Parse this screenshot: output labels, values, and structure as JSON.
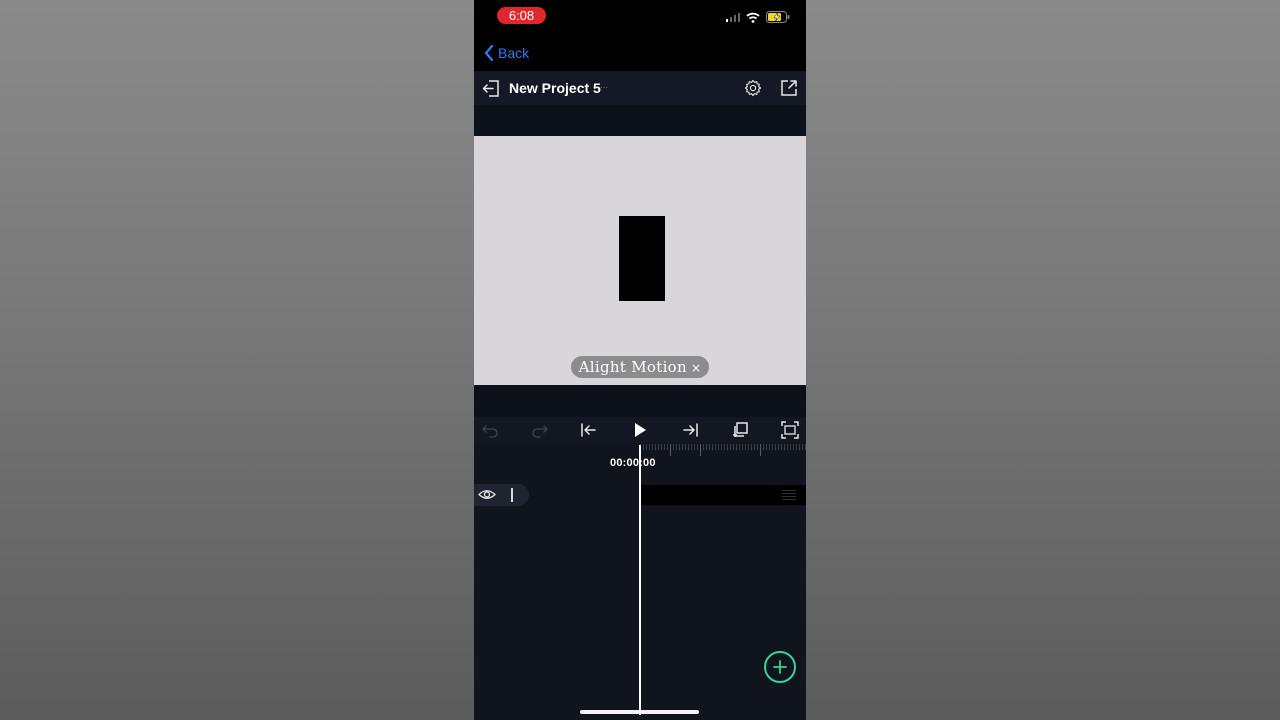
{
  "status_bar": {
    "time": "6:08"
  },
  "nav": {
    "back_label": "Back"
  },
  "project": {
    "title": "New Project 5",
    "title_suffix": "..."
  },
  "canvas": {
    "watermark_text": "Alight Motion",
    "watermark_close": "×"
  },
  "timeline": {
    "timecode": "00:00:00"
  },
  "colors": {
    "accent_blue": "#2f7cf6",
    "add_button_green": "#38d39a",
    "time_pill_red": "#e0272b",
    "canvas_bg": "#d8d6da"
  },
  "icons": {
    "status": [
      "cellular-signal-icon",
      "wifi-icon",
      "battery-charging-icon"
    ],
    "toolbar": [
      "undo-icon",
      "redo-icon",
      "skip-to-start-icon",
      "play-icon",
      "skip-to-end-icon",
      "duplicate-icon",
      "fit-view-icon"
    ],
    "header": [
      "exit-project-icon",
      "gear-icon",
      "export-icon"
    ],
    "layer": [
      "eye-icon"
    ],
    "fab": "plus-icon"
  }
}
